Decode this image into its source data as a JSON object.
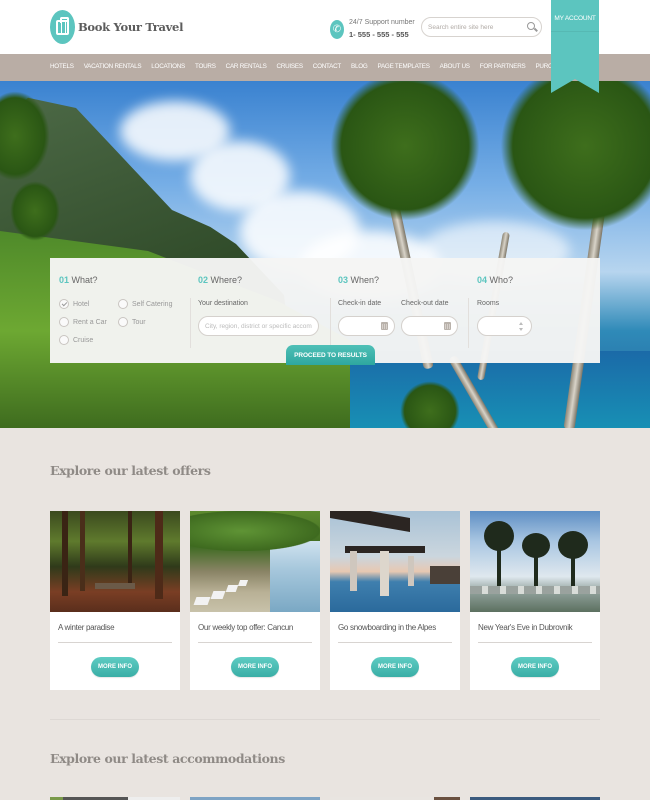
{
  "brand": {
    "name": "Book Your Travel",
    "logo_icon": "suitcase-icon",
    "accent_color": "#5cc5bf",
    "nav_color": "#b9ada5"
  },
  "header": {
    "support_label": "24/7 Support number",
    "support_number": "1- 555 - 555 - 555",
    "phone_icon": "phone-icon",
    "search_placeholder": "Search entire site here",
    "search_icon": "search-icon",
    "account_label": "MY ACCOUNT"
  },
  "nav": {
    "items": [
      "HOTELS",
      "VACATION RENTALS",
      "LOCATIONS",
      "TOURS",
      "CAR RENTALS",
      "CRUISES",
      "CONTACT",
      "BLOG",
      "PAGE TEMPLATES",
      "ABOUT US",
      "FOR PARTNERS",
      "PURCHASE THEME"
    ]
  },
  "search_panel": {
    "what": {
      "num": "01",
      "title": "What?",
      "options": [
        {
          "label": "Hotel",
          "checked": true
        },
        {
          "label": "Self Catering",
          "checked": false
        },
        {
          "label": "Rent a Car",
          "checked": false
        },
        {
          "label": "Tour",
          "checked": false
        },
        {
          "label": "Cruise",
          "checked": false
        }
      ]
    },
    "where": {
      "num": "02",
      "title": "Where?",
      "label": "Your destination",
      "placeholder": "City, region, district or specific accommodation"
    },
    "when": {
      "num": "03",
      "title": "When?",
      "checkin_label": "Check-in date",
      "checkout_label": "Check-out date",
      "checkin_value": "",
      "checkout_value": ""
    },
    "who": {
      "num": "04",
      "title": "Who?",
      "rooms_label": "Rooms",
      "rooms_value": ""
    },
    "submit_label": "PROCEED TO RESULTS"
  },
  "offers": {
    "title": "Explore our latest offers",
    "cards": [
      {
        "title": "A winter paradise",
        "button": "MORE INFO",
        "image": "forest-photo"
      },
      {
        "title": "Our weekly top offer: Cancun",
        "button": "MORE INFO",
        "image": "beach-loungers-photo"
      },
      {
        "title": "Go snowboarding in the Alpes",
        "button": "MORE INFO",
        "image": "pool-pergola-photo"
      },
      {
        "title": "New Year's Eve in Dubrovnik",
        "button": "MORE INFO",
        "image": "palm-beach-photo"
      }
    ]
  },
  "accommodations": {
    "title": "Explore our latest accommodations"
  }
}
